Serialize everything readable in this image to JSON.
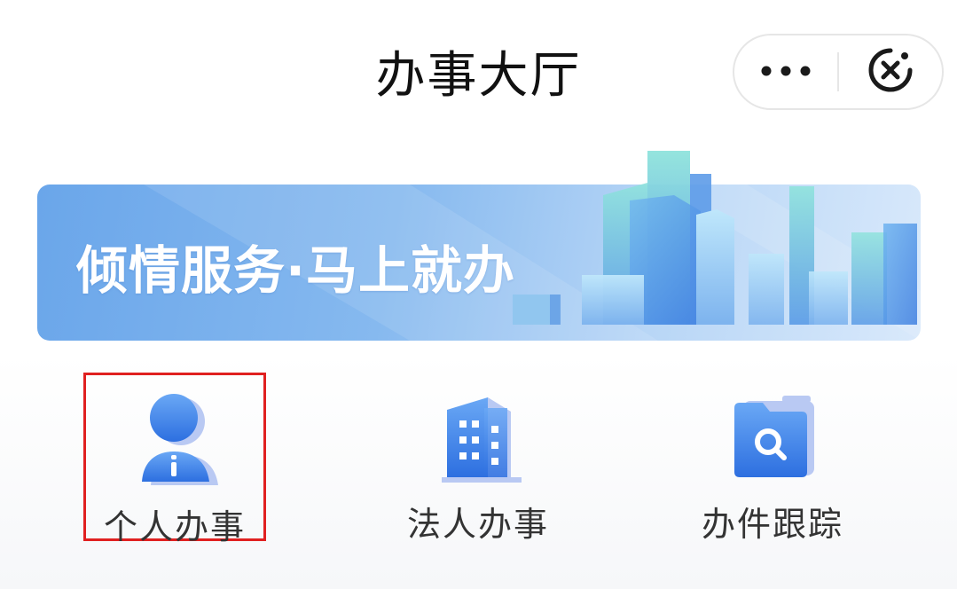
{
  "header": {
    "title": "办事大厅",
    "more_icon": "more-dots-icon",
    "close_icon": "close-circle-icon"
  },
  "banner": {
    "slogan": "倾情服务·马上就办"
  },
  "services": [
    {
      "label": "个人办事",
      "icon": "person-icon",
      "selected": true
    },
    {
      "label": "法人办事",
      "icon": "building-icon",
      "selected": false
    },
    {
      "label": "办件跟踪",
      "icon": "folder-search-icon",
      "selected": false
    }
  ],
  "colors": {
    "highlight_border": "#e02020",
    "icon_blue": "#3f7fe6",
    "banner_blue": "#6aa6ea"
  }
}
